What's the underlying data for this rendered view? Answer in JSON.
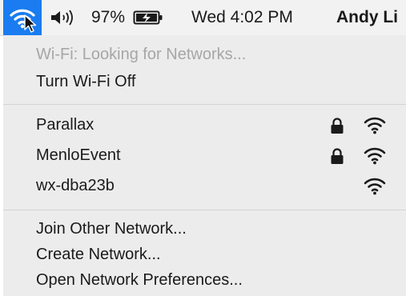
{
  "menubar": {
    "volume_icon": "speaker-volume-icon",
    "battery_percent": "97%",
    "battery_icon": "battery-charging-icon",
    "clock": "Wed 4:02 PM",
    "user": "Andy Li"
  },
  "wifi_menu": {
    "status": "Wi-Fi: Looking for Networks...",
    "toggle_label": "Turn Wi-Fi Off",
    "networks": [
      {
        "name": "Parallax",
        "locked": true
      },
      {
        "name": "MenloEvent",
        "locked": true
      },
      {
        "name": "wx-dba23b",
        "locked": false
      }
    ],
    "actions": {
      "join_other": "Join Other Network...",
      "create": "Create Network...",
      "preferences": "Open Network Preferences..."
    }
  },
  "colors": {
    "accent": "#1a7cf0",
    "menu_bg": "#ececec",
    "disabled_text": "#a6a6a6"
  }
}
